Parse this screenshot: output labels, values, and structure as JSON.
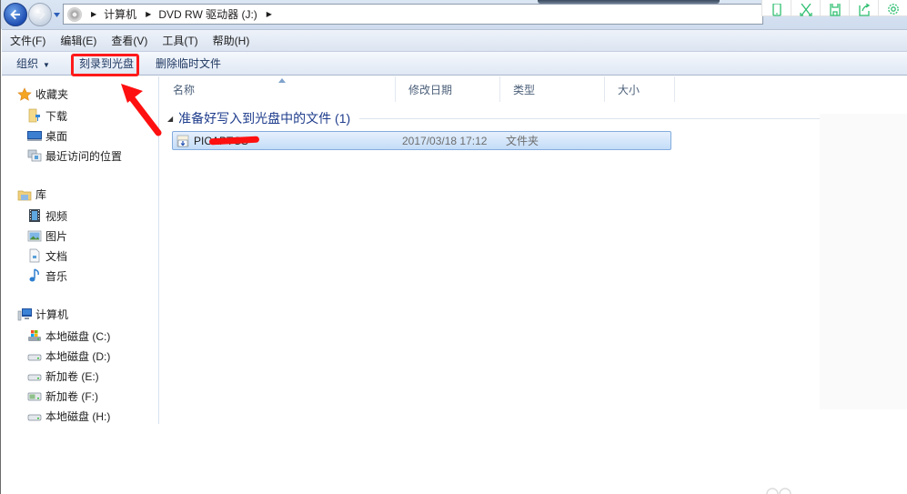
{
  "address_bar": {
    "breadcrumbs": [
      "计算机",
      "DVD RW 驱动器 (J:)"
    ],
    "drive_icon": "dvd-drive-icon"
  },
  "float_toolbar": {
    "icons": [
      "phone-icon",
      "fullscreen-icon",
      "save-icon",
      "share-icon",
      "settings-icon"
    ],
    "color": "#2fbf71"
  },
  "menubar": {
    "items": [
      "文件(F)",
      "编辑(E)",
      "查看(V)",
      "工具(T)",
      "帮助(H)"
    ]
  },
  "command_bar": {
    "organize": "组织",
    "burn": "刻录到光盘",
    "delete_temp": "删除临时文件"
  },
  "nav_pane": {
    "favorites": {
      "label": "收藏夹",
      "items": [
        "下载",
        "桌面",
        "最近访问的位置"
      ]
    },
    "libraries": {
      "label": "库",
      "items": [
        "视频",
        "图片",
        "文档",
        "音乐"
      ]
    },
    "computer": {
      "label": "计算机",
      "items": [
        "本地磁盘 (C:)",
        "本地磁盘 (D:)",
        "新加卷 (E:)",
        "新加卷 (F:)",
        "本地磁盘 (H:)"
      ]
    }
  },
  "content": {
    "columns": [
      "名称",
      "修改日期",
      "类型",
      "大小"
    ],
    "group_title": "准备好写入到光盘中的文件 (1)",
    "files": [
      {
        "name": "PICAPTCS",
        "date": "2017/03/18 17:12",
        "type": "文件夹",
        "size": ""
      }
    ]
  },
  "annotations": {
    "highlight_color": "#ff1a1a"
  }
}
